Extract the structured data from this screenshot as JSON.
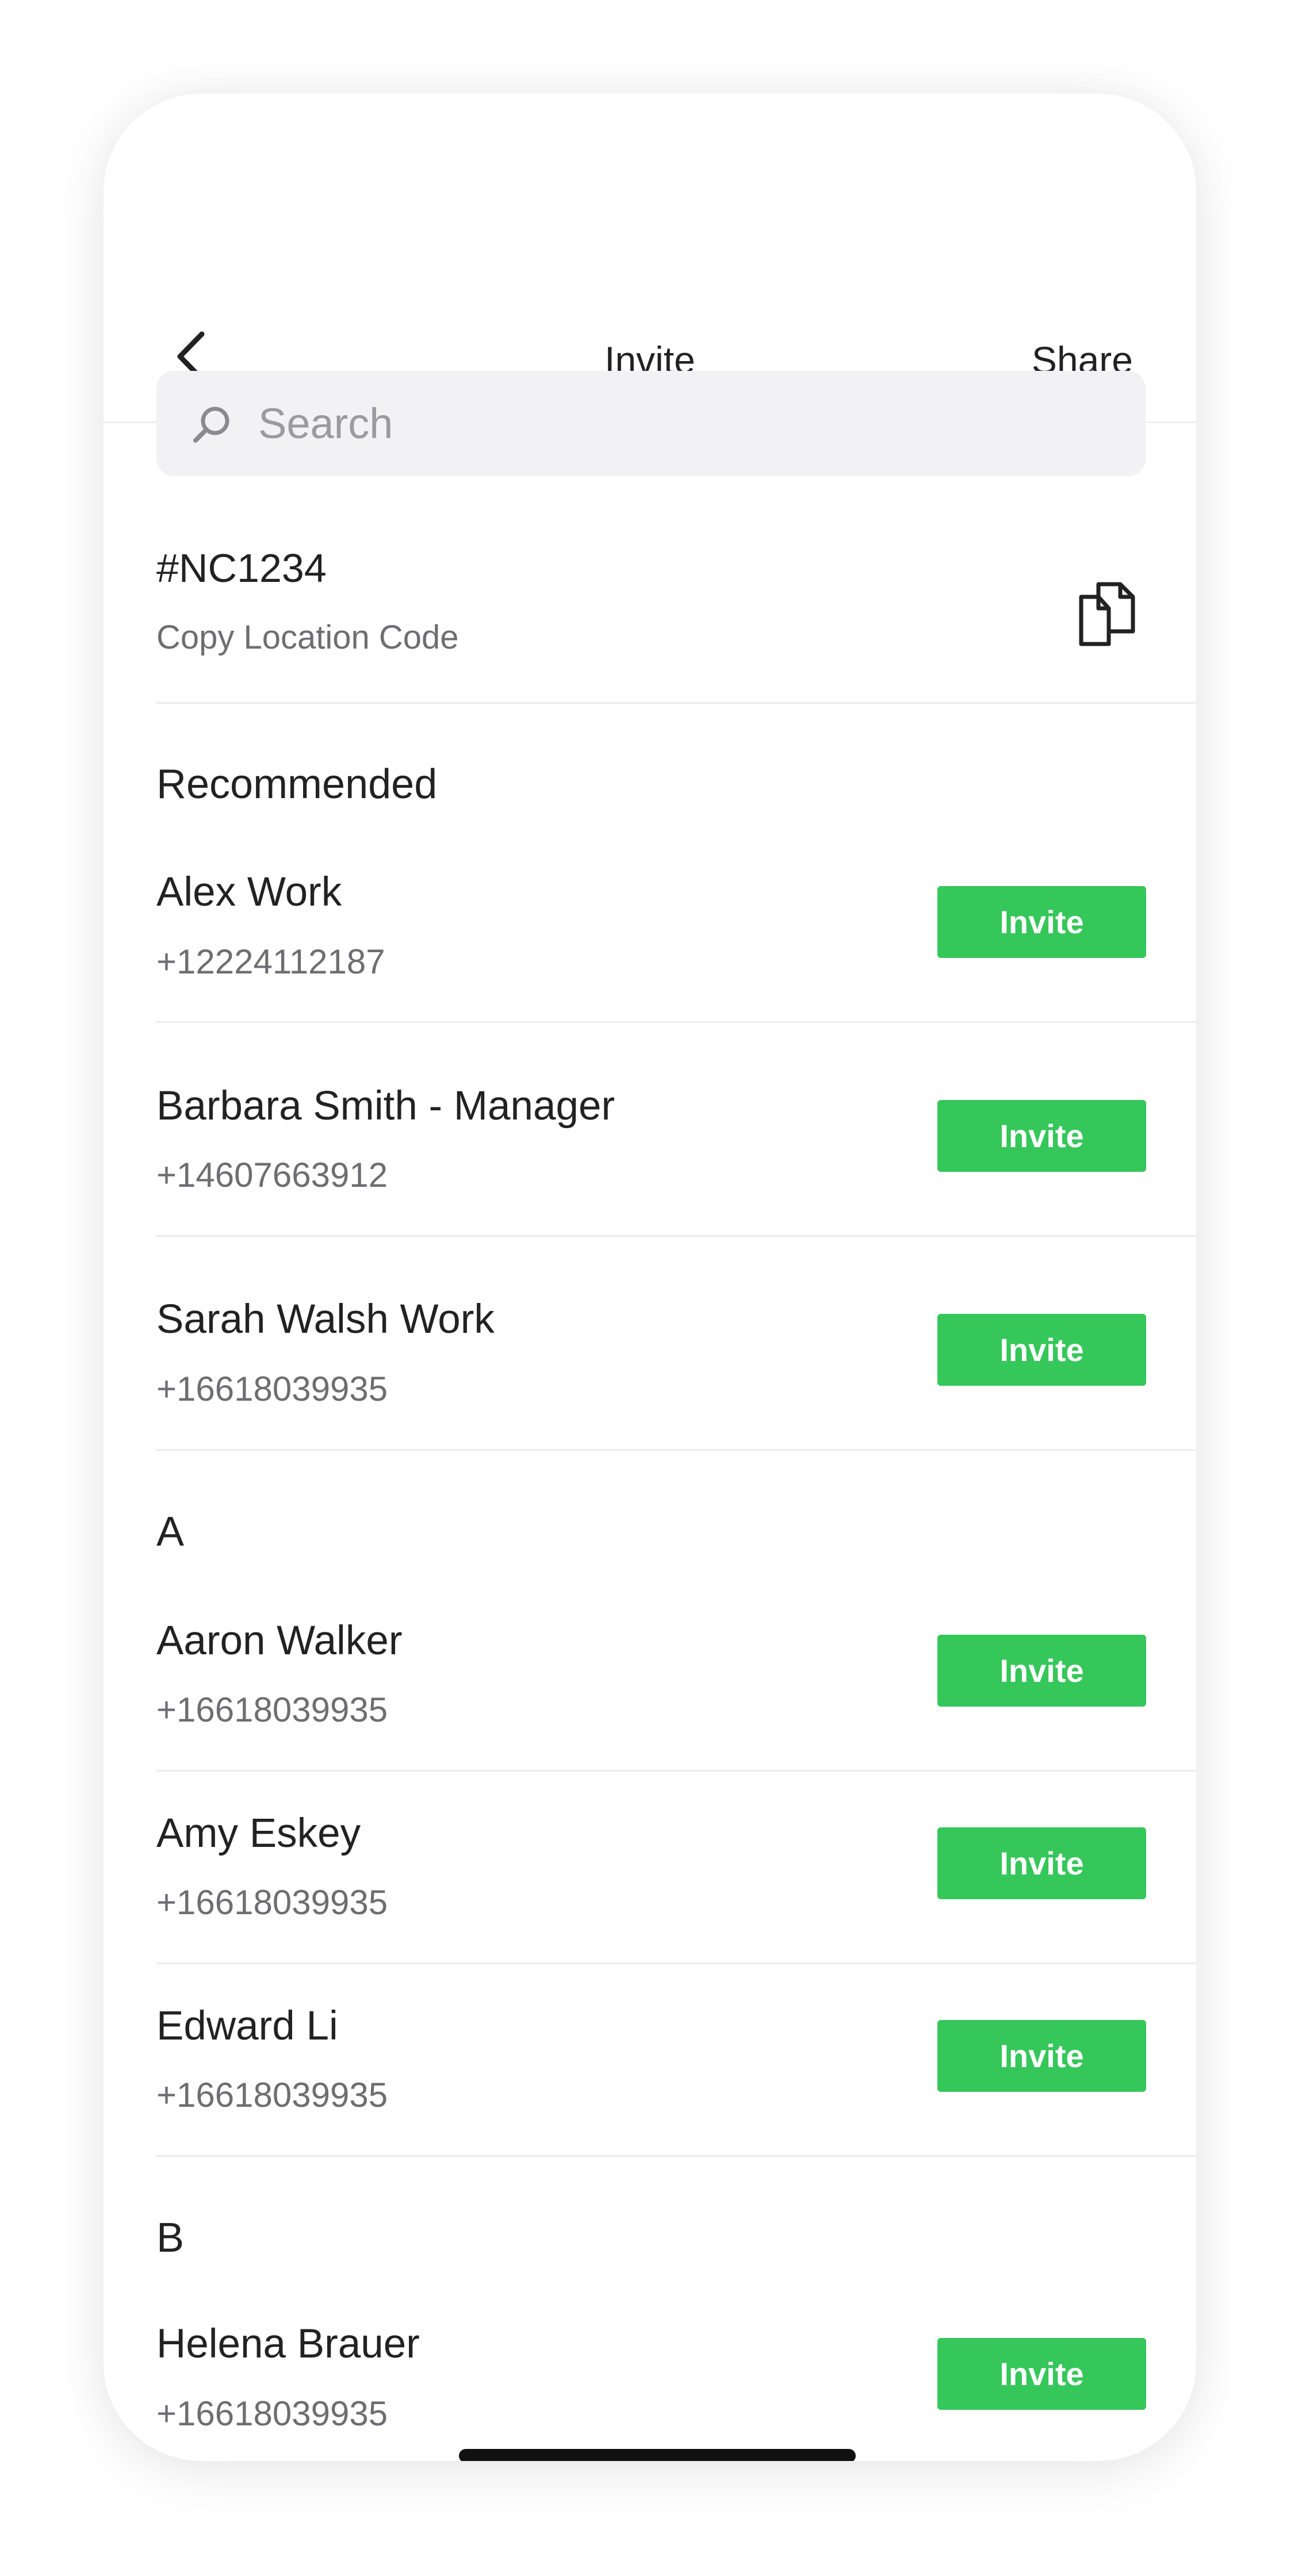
{
  "header": {
    "title": "Invite",
    "share_label": "Share"
  },
  "search": {
    "placeholder": "Search"
  },
  "location": {
    "code": "#NC1234",
    "copy_label": "Copy Location Code"
  },
  "sections": {
    "recommended": "Recommended",
    "a": "A",
    "b": "B"
  },
  "contacts": [
    {
      "name": "Alex Work",
      "phone": "+12224112187",
      "button": "Invite"
    },
    {
      "name": "Barbara Smith - Manager",
      "phone": "+14607663912",
      "button": "Invite"
    },
    {
      "name": "Sarah Walsh Work",
      "phone": "+16618039935",
      "button": "Invite"
    },
    {
      "name": "Aaron Walker",
      "phone": "+16618039935",
      "button": "Invite"
    },
    {
      "name": "Amy Eskey",
      "phone": "+16618039935",
      "button": "Invite"
    },
    {
      "name": "Edward Li",
      "phone": "+16618039935",
      "button": "Invite"
    },
    {
      "name": "Helena Brauer",
      "phone": "+16618039935",
      "button": "Invite"
    }
  ],
  "colors": {
    "invite_button": "#35c75a",
    "text_primary": "#222222",
    "text_secondary": "#6d6d72"
  }
}
